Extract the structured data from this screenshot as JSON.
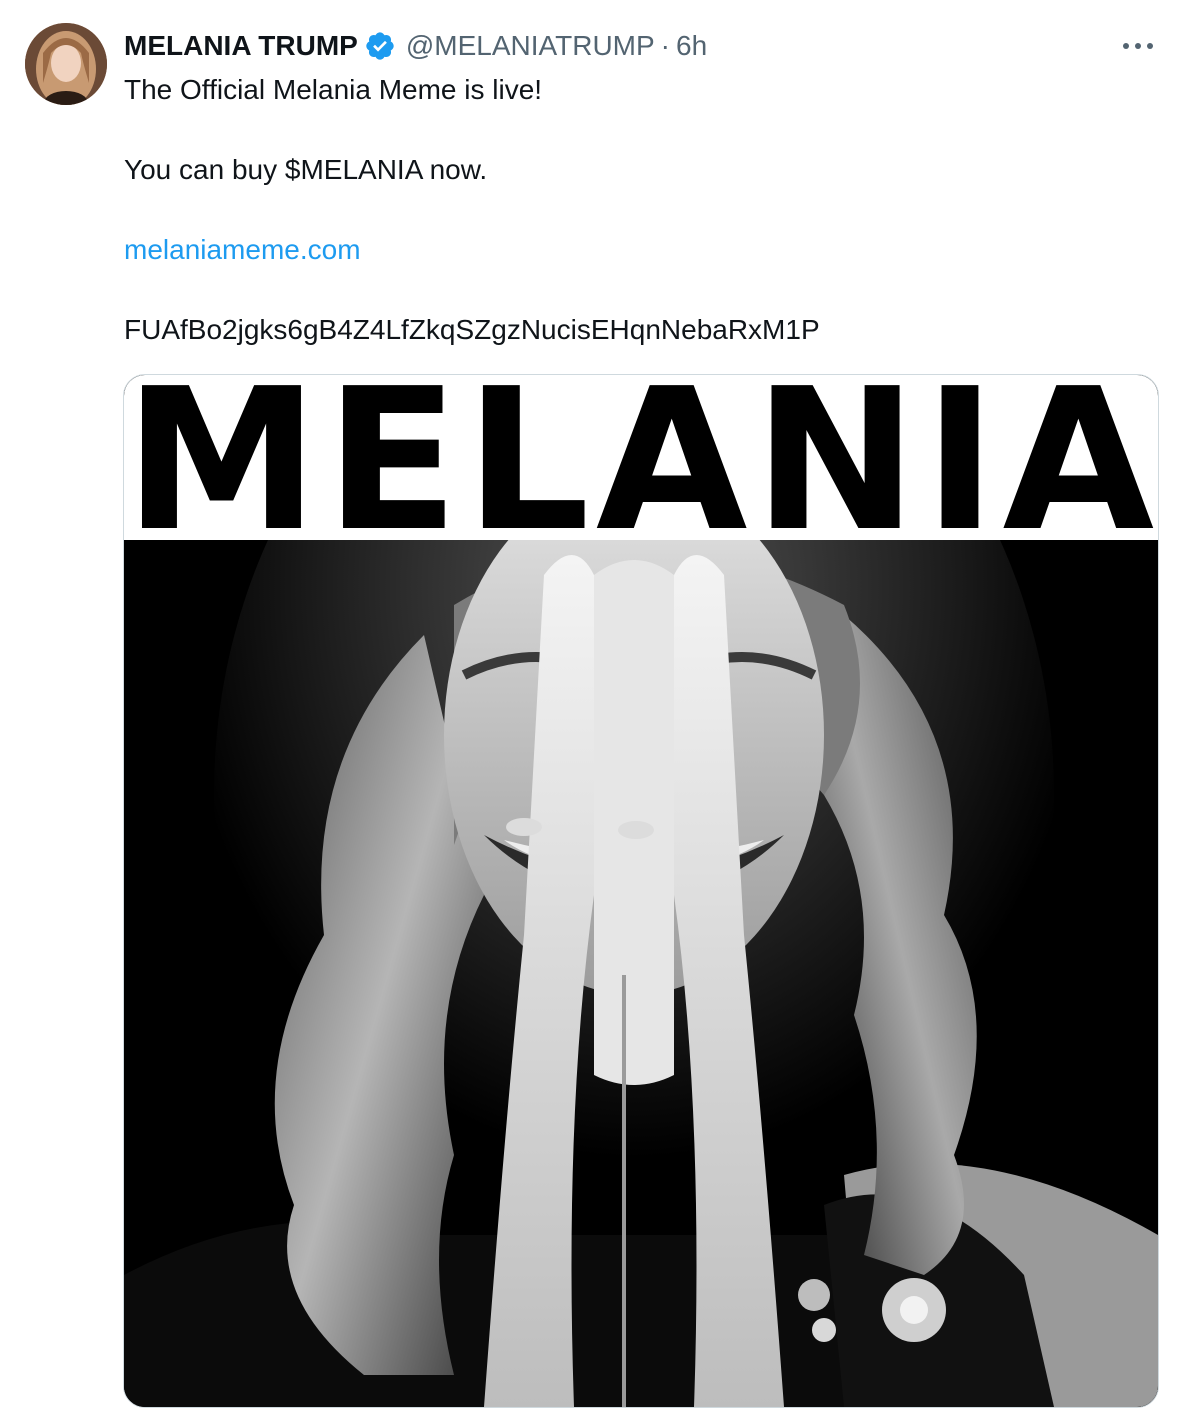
{
  "tweet": {
    "author": {
      "display_name": "MELANIA TRUMP",
      "handle": "@MELANIATRUMP",
      "verified_icon": "verified-badge-icon",
      "avatar_icon": "avatar"
    },
    "separator": "·",
    "time": "6h",
    "more_icon": "more-icon",
    "text": {
      "line1": "The Official Melania Meme is live!",
      "line2": "You can buy $MELANIA now.",
      "link": "melaniameme.com",
      "address": "FUAfBo2jgks6gB4Z4LfZkqSZgzNucisEHqnNebaRxM1P"
    },
    "media": {
      "title": "MELANIA"
    }
  },
  "colors": {
    "text": "#0f1419",
    "muted": "#536471",
    "link": "#1d9bf0",
    "verified": "#1d9bf0",
    "border": "#cfd9de"
  }
}
